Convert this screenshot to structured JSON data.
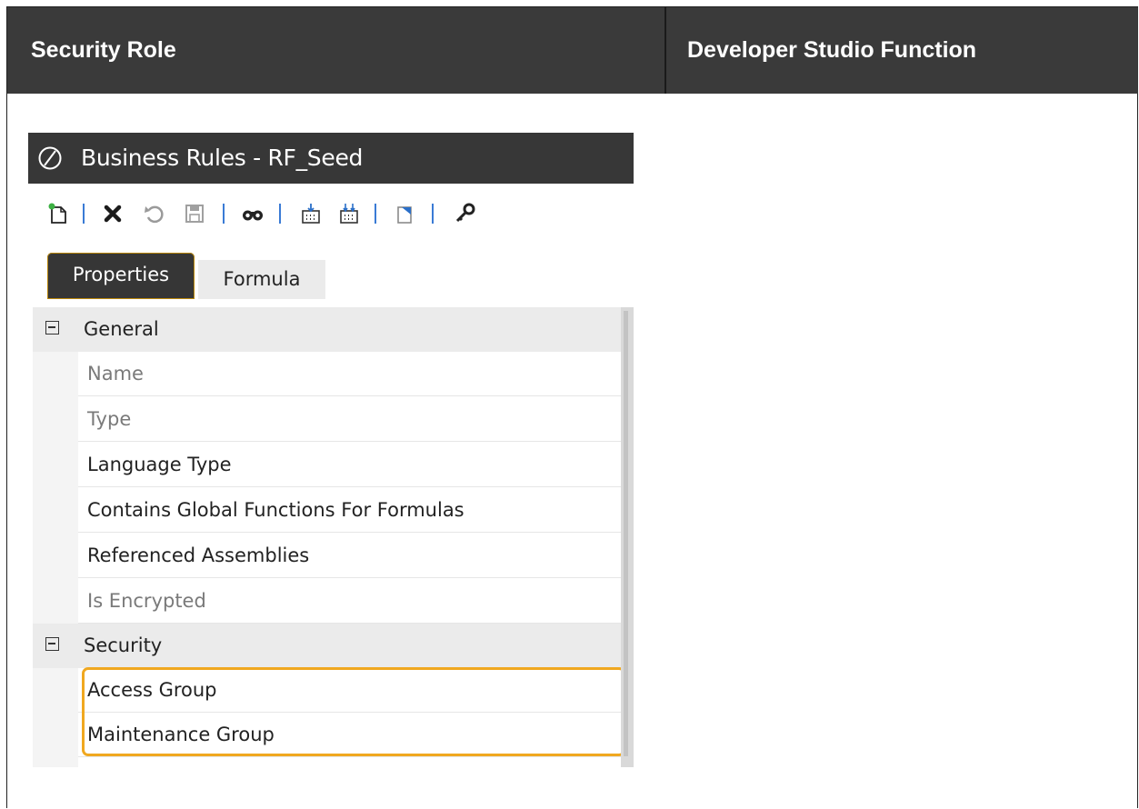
{
  "table": {
    "headers": [
      "Security Role",
      "Developer Studio Function"
    ]
  },
  "window": {
    "title": "Business Rules - RF_Seed",
    "app_icon": "onestream-logo-icon"
  },
  "toolbar": {
    "icons": [
      "new-document-icon",
      "delete-icon",
      "undo-icon",
      "save-icon",
      "binoculars-search-icon",
      "import-icon",
      "import-all-icon",
      "copy-icon",
      "key-icon"
    ]
  },
  "tabs": {
    "properties": "Properties",
    "formula": "Formula",
    "selected": "Properties"
  },
  "properties": {
    "general_category": "General",
    "general_rows": [
      "Name",
      "Type",
      "Language Type",
      "Contains Global Functions For Formulas",
      "Referenced Assemblies",
      "Is Encrypted"
    ],
    "security_category": "Security",
    "security_rows": [
      "Access Group",
      "Maintenance Group"
    ]
  },
  "colors": {
    "header_bg": "#3a3a3a",
    "titlebar_bg": "#373737",
    "highlight": "#f0a820",
    "separator": "#3a7bd5"
  }
}
